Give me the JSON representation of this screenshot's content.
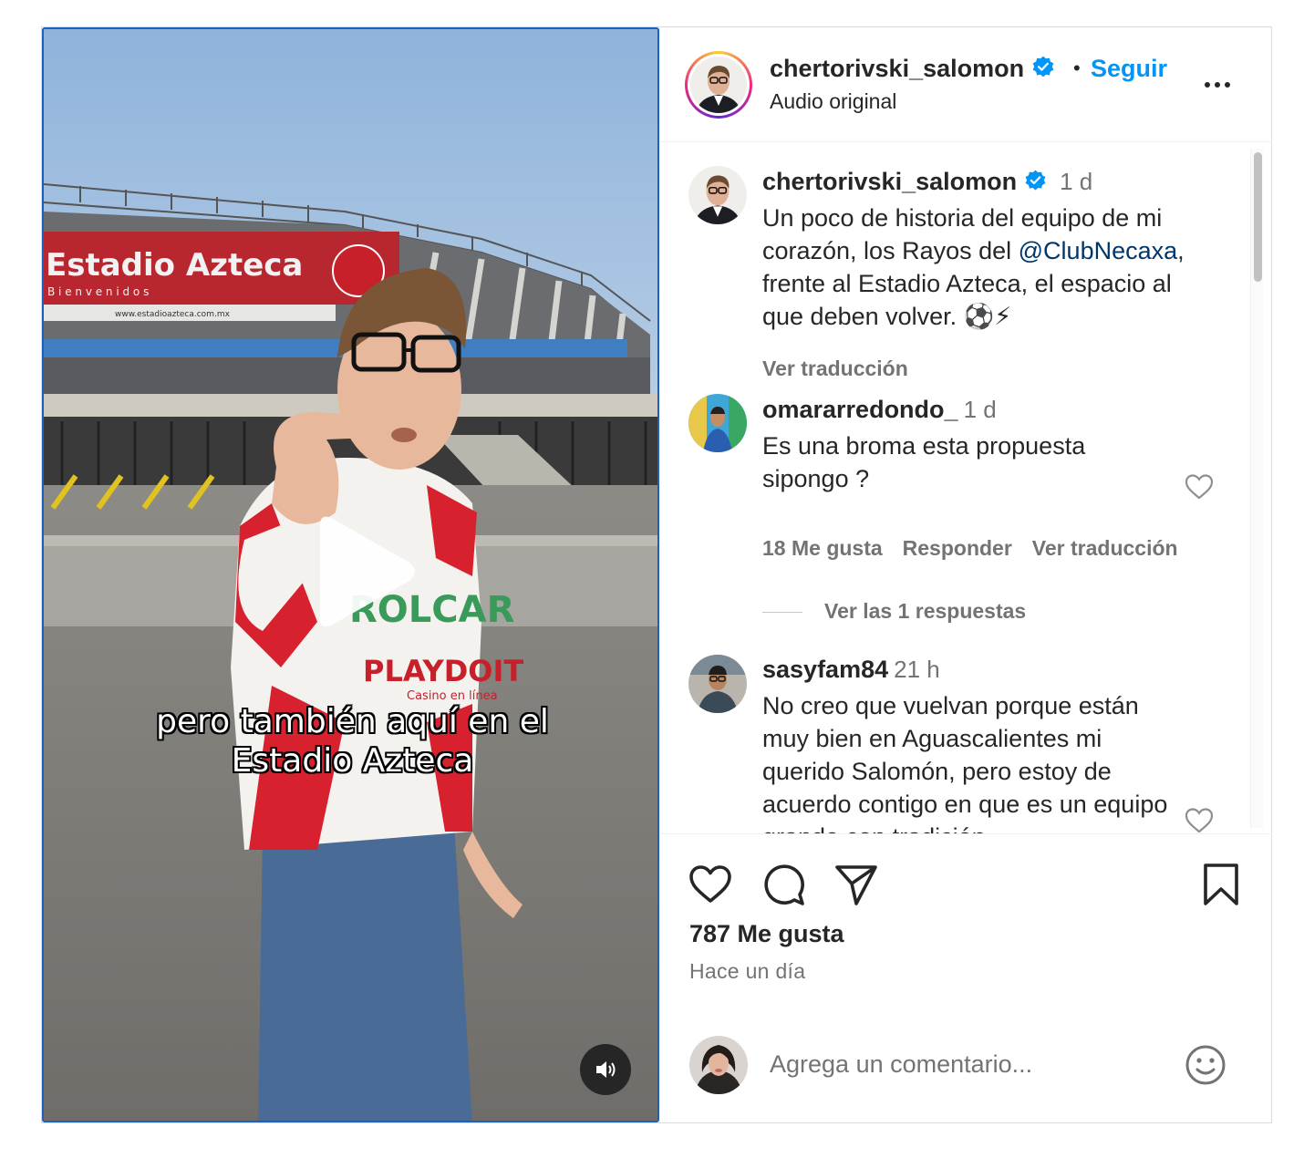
{
  "post": {
    "username": "chertorivski_salomon",
    "follow_label": "Seguir",
    "separator": "•",
    "audio": "Audio original"
  },
  "media": {
    "overlay_line1": "pero también aquí en el",
    "overlay_line2": "Estadio Azteca",
    "stadium_sign": "Estadio Azteca",
    "stadium_sub": "B i e n v e n i d o s",
    "stadium_url": "www.estadioazteca.com.mx",
    "shirt_sponsor1": "ROLCAR",
    "shirt_sponsor2": "PLAYDOIT",
    "shirt_sponsor3": "Casino en línea"
  },
  "caption": {
    "username": "chertorivski_salomon",
    "time": "1 d",
    "text_before": "Un poco de historia del equipo de mi corazón, los Rayos del ",
    "mention": "@ClubNecaxa",
    "text_after": ", frente al Estadio Azteca, el espacio al que deben volver. ⚽⚡",
    "translate": "Ver traducción"
  },
  "comments": [
    {
      "username": "omararredondo_",
      "time": "1 d",
      "text": "Es una broma esta propuesta sipongo ?",
      "likes": "18 Me gusta",
      "reply": "Responder",
      "translate": "Ver traducción",
      "view_replies": "Ver las 1 respuestas"
    },
    {
      "username": "sasyfam84",
      "time": "21 h",
      "text": "No creo que vuelvan porque están muy bien en Aguascalientes mi querido Salomón, pero estoy de acuerdo contigo en que es un equipo grande con tradición."
    }
  ],
  "actions": {
    "likes": "787 Me gusta",
    "time_ago": "Hace un día"
  },
  "add_comment": {
    "placeholder": "Agrega un comentario..."
  },
  "icons": {
    "like": "heart-icon",
    "comment": "comment-icon",
    "share": "share-icon",
    "save": "bookmark-icon",
    "verified": "verified-badge-icon",
    "more": "more-options-icon",
    "emoji": "emoji-icon",
    "play": "play-icon",
    "volume": "volume-icon"
  },
  "colors": {
    "accent": "#0095f6",
    "mention": "#00376b",
    "muted": "#737373"
  }
}
